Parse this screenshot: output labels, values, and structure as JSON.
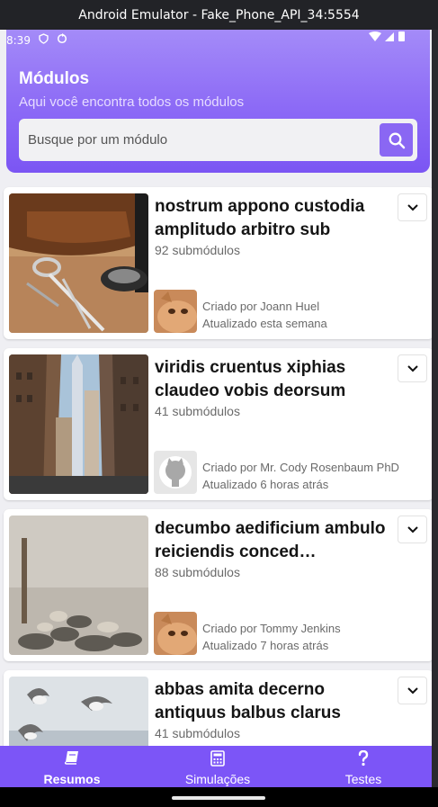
{
  "window": {
    "title": "Android Emulator - Fake_Phone_API_34:5554"
  },
  "status_bar": {
    "time": "8:39"
  },
  "header": {
    "title": "Módulos",
    "subtitle": "Aqui você encontra todos os módulos",
    "search_placeholder": "Busque por um módulo"
  },
  "modules": [
    {
      "title": "nostrum appono custodia amplitudo arbitro sub",
      "count": "92 submódulos",
      "author": "Criado por Joann Huel",
      "updated": "Atualizado esta semana",
      "thumb_icon": "leather-tools-photo",
      "avatar_icon": "cat-avatar"
    },
    {
      "title": "viridis cruentus xiphias claudeo vobis deorsum",
      "count": "41 submódulos",
      "author": "Criado por Mr. Cody Rosenbaum PhD",
      "updated": "Atualizado 6 horas atrás",
      "thumb_icon": "city-street-photo",
      "avatar_icon": "github-avatar"
    },
    {
      "title": "decumbo aedificium ambulo reiciendis conced…",
      "count": "88 submódulos",
      "author": "Criado por Tommy Jenkins",
      "updated": "Atualizado 7 horas atrás",
      "thumb_icon": "rocky-shore-photo",
      "avatar_icon": "cat-avatar"
    },
    {
      "title": "abbas amita decerno antiquus balbus clarus",
      "count": "41 submódulos",
      "author": "",
      "updated": "",
      "thumb_icon": "seagulls-photo",
      "avatar_icon": ""
    }
  ],
  "nav": [
    {
      "label": "Resumos",
      "icon": "book-icon",
      "active": true
    },
    {
      "label": "Simulações",
      "icon": "calculator-icon",
      "active": false
    },
    {
      "label": "Testes",
      "icon": "question-icon",
      "active": false
    }
  ],
  "colors": {
    "accent": "#7c55f7",
    "header_top": "#a48bf8",
    "search_button": "#8a67f3"
  }
}
